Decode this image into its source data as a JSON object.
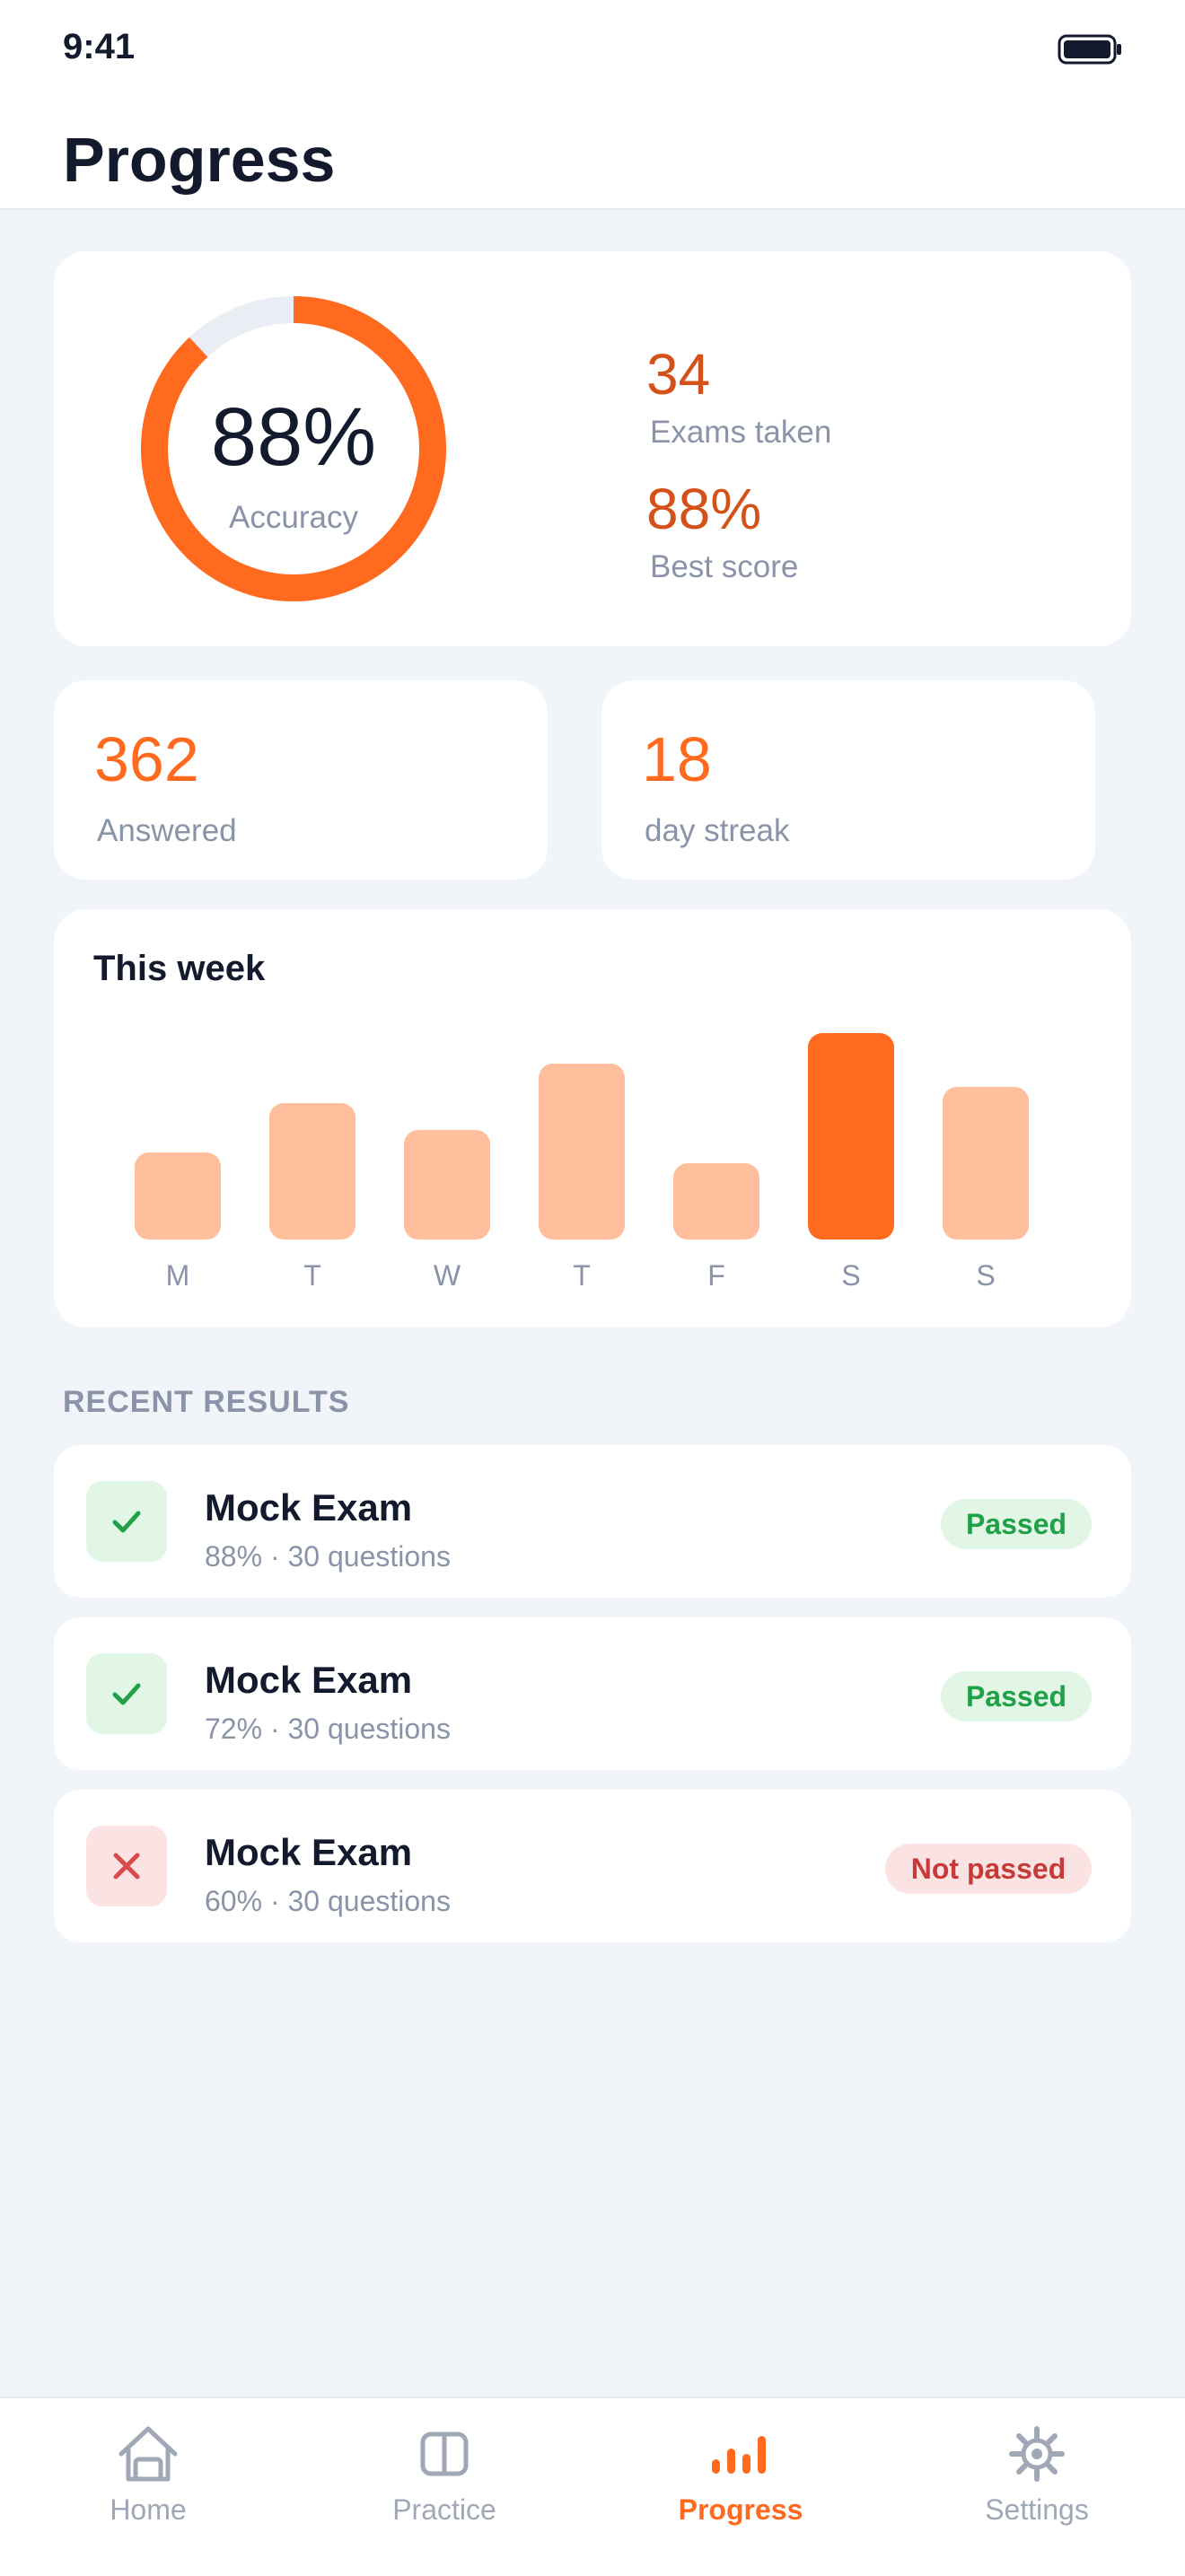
{
  "status_bar": {
    "time": "9:41"
  },
  "header": {
    "title": "Progress"
  },
  "overview": {
    "accuracy_value": "88%",
    "accuracy_label": "Accuracy",
    "accuracy_fraction": 0.88,
    "exams_taken_value": "34",
    "exams_taken_label": "Exams taken",
    "best_score_value": "88%",
    "best_score_label": "Best score"
  },
  "answered": {
    "value": "362",
    "label": "Answered"
  },
  "streak": {
    "value": "18",
    "label": "day streak"
  },
  "week": {
    "title": "This week",
    "days": [
      {
        "label": "M",
        "level": 0.42,
        "active": false
      },
      {
        "label": "T",
        "level": 0.66,
        "active": false
      },
      {
        "label": "W",
        "level": 0.53,
        "active": false
      },
      {
        "label": "T",
        "level": 0.85,
        "active": false
      },
      {
        "label": "F",
        "level": 0.37,
        "active": false
      },
      {
        "label": "S",
        "level": 1.0,
        "active": true
      },
      {
        "label": "S",
        "level": 0.74,
        "active": false
      }
    ]
  },
  "recent": {
    "section_label": "RECENT RESULTS",
    "items": [
      {
        "title": "Mock Exam",
        "subtitle": "88% · 30 questions",
        "status": "Passed",
        "passed": true
      },
      {
        "title": "Mock Exam",
        "subtitle": "72% · 30 questions",
        "status": "Passed",
        "passed": true
      },
      {
        "title": "Mock Exam",
        "subtitle": "60% · 30 questions",
        "status": "Not passed",
        "passed": false
      }
    ]
  },
  "tabs": [
    {
      "label": "Home",
      "icon": "home-icon",
      "active": false
    },
    {
      "label": "Practice",
      "icon": "book-icon",
      "active": false
    },
    {
      "label": "Progress",
      "icon": "bar-chart-icon",
      "active": true
    },
    {
      "label": "Settings",
      "icon": "gear-icon",
      "active": false
    }
  ],
  "colors": {
    "accent": "#ff6a1f",
    "accent_light": "#ffbe9c",
    "stat_text": "#d4521a",
    "pass_green": "#21a048",
    "fail_red": "#c63a3a"
  }
}
